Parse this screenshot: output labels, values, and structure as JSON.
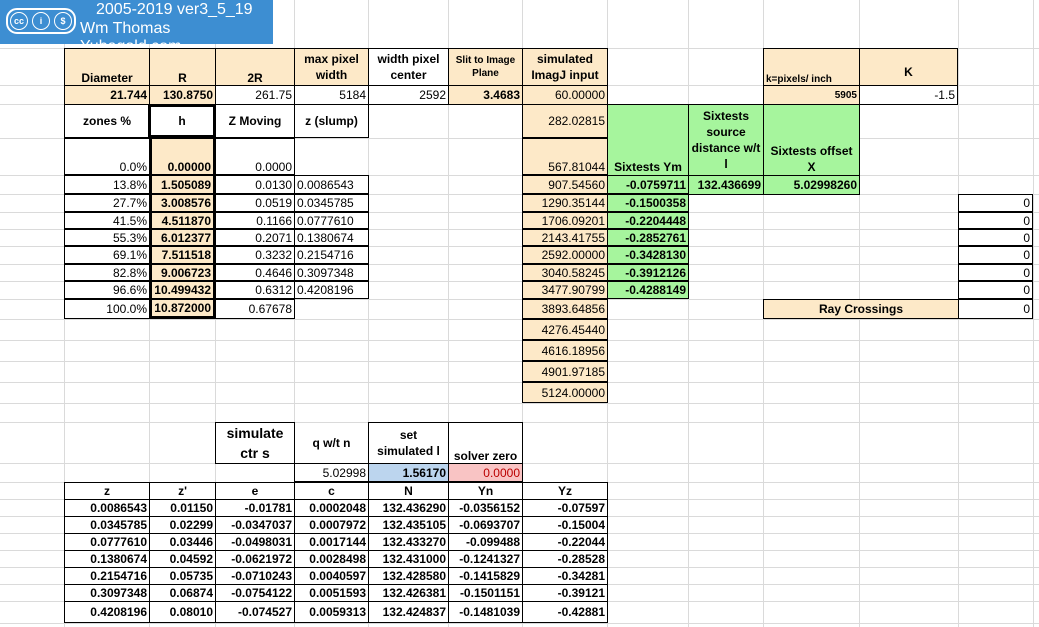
{
  "logo": {
    "line1": "2005-2019 ver3_5_19",
    "line2": "Wm Thomas Yubagold.com",
    "badge_icons": [
      "cc-icon",
      "by-icon",
      "nc-icon",
      "sa-icon"
    ]
  },
  "params": {
    "diameter_label": "Diameter",
    "diameter": "21.744",
    "r_label": "R",
    "r": "130.8750",
    "r2_label": "2R",
    "r2": "261.75",
    "maxpix_label": "max pixel width",
    "maxpix": "5184",
    "widthpix_label": "width pixel center",
    "widthpix": "2592",
    "slit_label": "Slit to Image Plane",
    "slit": "3.4683",
    "sim_label": "simulated ImagJ input",
    "sim": "60.00000",
    "kpix_label": "k=pixels/ inch",
    "kpix": "5905",
    "k_label": "K",
    "k": "-1.5"
  },
  "zones_header": {
    "zones": "zones %",
    "h": "h",
    "zmov": "Z Moving",
    "zslump": "z (slump)"
  },
  "zones": [
    {
      "pct": "0.0%",
      "h": "0.00000",
      "zm": "0.0000",
      "zs": ""
    },
    {
      "pct": "13.8%",
      "h": "1.505089",
      "zm": "0.0130",
      "zs": "0.0086543"
    },
    {
      "pct": "27.7%",
      "h": "3.008576",
      "zm": "0.0519",
      "zs": "0.0345785"
    },
    {
      "pct": "41.5%",
      "h": "4.511870",
      "zm": "0.1166",
      "zs": "0.0777610"
    },
    {
      "pct": "55.3%",
      "h": "6.012377",
      "zm": "0.2071",
      "zs": "0.1380674"
    },
    {
      "pct": "69.1%",
      "h": "7.511518",
      "zm": "0.3232",
      "zs": "0.2154716"
    },
    {
      "pct": "82.8%",
      "h": "9.006723",
      "zm": "0.4646",
      "zs": "0.3097348"
    },
    {
      "pct": "96.6%",
      "h": "10.499432",
      "zm": "0.6312",
      "zs": "0.4208196"
    },
    {
      "pct": "100.0%",
      "h": "10.872000",
      "zm": "0.67678",
      "zs": ""
    }
  ],
  "sim_col": [
    "282.02815",
    "567.81044",
    "907.54560",
    "1290.35144",
    "1706.09201",
    "2143.41755",
    "2592.00000",
    "3040.58245",
    "3477.90799",
    "3893.64856",
    "4276.45440",
    "4616.18956",
    "4901.97185",
    "5124.00000"
  ],
  "sixtests": {
    "ym_label": "Sixtests Ym",
    "dist_label": "Sixtests source distance w/t l",
    "offset_label": "Sixtests offset X",
    "ym": [
      "-0.0759711",
      "-0.1500358",
      "-0.2204448",
      "-0.2852761",
      "-0.3428130",
      "-0.3912126",
      "-0.4288149"
    ],
    "dist": "132.436699",
    "offset": "5.02998260"
  },
  "right_col": [
    "0",
    "0",
    "0",
    "0",
    "0",
    "0"
  ],
  "ray": {
    "label": "Ray Crossings",
    "value": "0"
  },
  "solver": {
    "ctr_label": "simulate ctr s",
    "q_label": "q w/t n",
    "set_label": "set simulated l",
    "zero_label": "solver zero",
    "q": "5.02998",
    "set": "1.56170",
    "zero": "0.0000"
  },
  "bottom": {
    "headers": [
      "z",
      "z'",
      "e",
      "c",
      "N",
      "Yn",
      "Yz"
    ],
    "rows": [
      [
        "0.0086543",
        "0.01150",
        "-0.01781",
        "0.0002048",
        "132.436290",
        "-0.0356152",
        "-0.07597"
      ],
      [
        "0.0345785",
        "0.02299",
        "-0.0347037",
        "0.0007972",
        "132.435105",
        "-0.0693707",
        "-0.15004"
      ],
      [
        "0.0777610",
        "0.03446",
        "-0.0498031",
        "0.0017144",
        "132.433270",
        "-0.099488",
        "-0.22044"
      ],
      [
        "0.1380674",
        "0.04592",
        "-0.0621972",
        "0.0028498",
        "132.431000",
        "-0.1241327",
        "-0.28528"
      ],
      [
        "0.2154716",
        "0.05735",
        "-0.0710243",
        "0.0040597",
        "132.428580",
        "-0.1415829",
        "-0.34281"
      ],
      [
        "0.3097348",
        "0.06874",
        "-0.0754122",
        "0.0051593",
        "132.426381",
        "-0.1501151",
        "-0.39121"
      ],
      [
        "0.4208196",
        "0.08010",
        "-0.074527",
        "0.0059313",
        "132.424837",
        "-0.1481039",
        "-0.42881"
      ]
    ]
  }
}
